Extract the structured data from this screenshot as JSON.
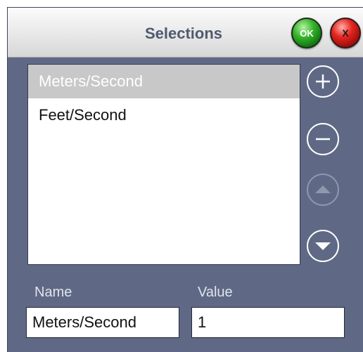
{
  "titlebar": {
    "title": "Selections",
    "ok_label": "OK",
    "close_label": "X",
    "ok_color": "#2aa624",
    "close_color": "#d41e1a"
  },
  "list": {
    "items": [
      {
        "label": "Meters/Second",
        "selected": true
      },
      {
        "label": "Feet/Second",
        "selected": false
      }
    ]
  },
  "side_buttons": [
    {
      "icon": "plus-icon",
      "enabled": true
    },
    {
      "icon": "minus-icon",
      "enabled": true
    },
    {
      "icon": "move-up-icon",
      "enabled": false
    },
    {
      "icon": "move-down-icon",
      "enabled": true
    }
  ],
  "fields": {
    "name_label": "Name",
    "name_value": "Meters/Second",
    "value_label": "Value",
    "value_value": "1"
  },
  "colors": {
    "panel_background": "#5f6985",
    "selected_row": "#c8c8c8"
  }
}
